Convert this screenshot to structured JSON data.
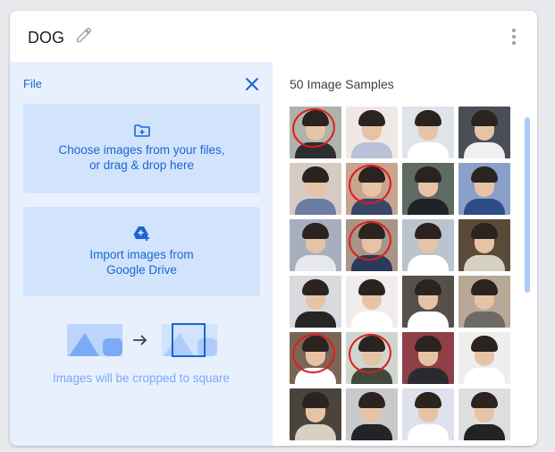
{
  "header": {
    "title": "DOG"
  },
  "left_panel": {
    "section_label": "File",
    "upload_tile": {
      "line1": "Choose images from your files,",
      "line2": "or drag & drop here"
    },
    "drive_tile": {
      "line1": "Import images from",
      "line2": "Google Drive"
    },
    "crop_note": "Images will be cropped to square"
  },
  "samples": {
    "title": "50 Image Samples",
    "thumbnails": [
      {
        "bg": "#aeb3ab",
        "shirt": "#2b2d31",
        "marked": true
      },
      {
        "bg": "#efe8e4",
        "shirt": "#b7c2d6",
        "marked": false
      },
      {
        "bg": "#dfe3ea",
        "shirt": "#ffffff",
        "marked": false
      },
      {
        "bg": "#4a4f57",
        "shirt": "#f0f0f0",
        "marked": false
      },
      {
        "bg": "#d6ccc4",
        "shirt": "#6b7da3",
        "marked": false
      },
      {
        "bg": "#c8a48f",
        "shirt": "#3a4666",
        "marked": true
      },
      {
        "bg": "#5f6a63",
        "shirt": "#1f2226",
        "marked": false
      },
      {
        "bg": "#8aa0c8",
        "shirt": "#2e4d88",
        "marked": false
      },
      {
        "bg": "#a7afbf",
        "shirt": "#e7e9ee",
        "marked": false
      },
      {
        "bg": "#a99587",
        "shirt": "#2c3a5a",
        "marked": true
      },
      {
        "bg": "#b9c4cf",
        "shirt": "#ffffff",
        "marked": false
      },
      {
        "bg": "#5b4a3a",
        "shirt": "#d7d1c4",
        "marked": false
      },
      {
        "bg": "#d9dadd",
        "shirt": "#262626",
        "marked": false
      },
      {
        "bg": "#f0eceb",
        "shirt": "#ffffff",
        "marked": false
      },
      {
        "bg": "#55504a",
        "shirt": "#ffffff",
        "marked": false
      },
      {
        "bg": "#b8a897",
        "shirt": "#6d6a66",
        "marked": false
      },
      {
        "bg": "#7b6554",
        "shirt": "#ffffff",
        "marked": true
      },
      {
        "bg": "#cfd6cf",
        "shirt": "#3f4a3c",
        "marked": true
      },
      {
        "bg": "#8f3f46",
        "shirt": "#2a2a30",
        "marked": false
      },
      {
        "bg": "#eeeeee",
        "shirt": "#ffffff",
        "marked": false
      },
      {
        "bg": "#4a443d",
        "shirt": "#d8d0c2",
        "marked": false
      },
      {
        "bg": "#c9c9cc",
        "shirt": "#222428",
        "marked": false
      },
      {
        "bg": "#dfe1ec",
        "shirt": "#ffffff",
        "marked": false
      },
      {
        "bg": "#dedede",
        "shirt": "#232323",
        "marked": false
      }
    ]
  },
  "colors": {
    "accent": "#1967d2",
    "tile_bg": "#d2e3fc",
    "panel_bg": "#e8f0fe",
    "annotation_red": "#e11b1b"
  },
  "icons": [
    "pencil-icon",
    "more-vert-icon",
    "close-icon",
    "folder-plus-icon",
    "drive-add-icon",
    "crop-diagram-icon"
  ]
}
